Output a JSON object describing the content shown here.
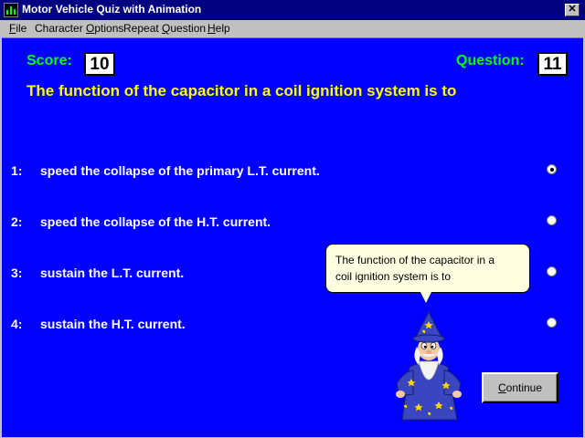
{
  "window": {
    "title": "Motor Vehicle Quiz with Animation",
    "app_icon": "quiz-app-icon",
    "close_glyph": "✕"
  },
  "menu": {
    "items": [
      {
        "accel": "F",
        "rest": "ile"
      },
      {
        "accel": "",
        "rest": "Character ",
        "accel2": "O",
        "rest2": "ptions"
      },
      {
        "accel": "",
        "rest": "Repeat ",
        "accel2": "Q",
        "rest2": "uestion"
      },
      {
        "accel": "H",
        "rest": "elp"
      }
    ]
  },
  "quiz": {
    "score_label": "Score:",
    "score_value": "10",
    "question_label": "Question:",
    "question_value": "11",
    "question_text": "The function of the capacitor in a coil ignition system is to",
    "answers": [
      {
        "number": "1:",
        "text": "speed the collapse of the primary L.T. current.",
        "selected": true
      },
      {
        "number": "2:",
        "text": "speed the collapse of the H.T. current.",
        "selected": false
      },
      {
        "number": "3:",
        "text": "sustain the L.T. current.",
        "selected": false
      },
      {
        "number": "4:",
        "text": "sustain the H.T. current.",
        "selected": false
      }
    ]
  },
  "character": {
    "speech_line1": "The function of the capacitor in a",
    "speech_line2": "coil ignition system is to",
    "icon": "wizard-character"
  },
  "buttons": {
    "continue_accel": "C",
    "continue_rest": "ontinue"
  },
  "colors": {
    "background": "#0000ff",
    "labels": "#00ff00",
    "question": "#ffff00",
    "answers": "#ffffff",
    "titlebar": "#000080"
  }
}
